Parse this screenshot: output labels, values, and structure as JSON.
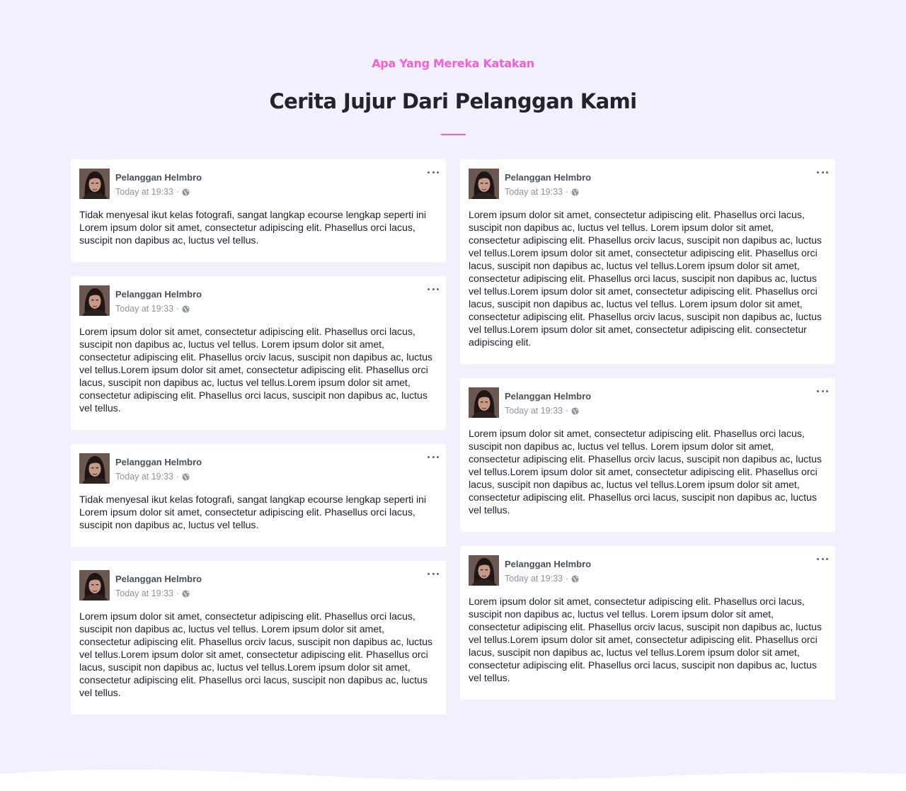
{
  "section": {
    "eyebrow": "Apa Yang Mereka Katakan",
    "title": "Cerita Jujur Dari Pelanggan Kami"
  },
  "colors": {
    "accent": "#f45fd9",
    "background": "#f2f0fc",
    "card": "#ffffff",
    "title": "#23232f"
  },
  "icons": {
    "more": "more-horizontal-icon",
    "privacy": "globe-icon",
    "avatar": "user-avatar"
  },
  "left_posts": [
    {
      "name": "Pelanggan Helmbro",
      "time": "Today at 19:33",
      "text": "Tidak menyesal ikut kelas fotografi, sangat langkap ecourse lengkap seperti ini Lorem ipsum dolor sit amet, consectetur adipiscing elit. Phasellus orci lacus, suscipit non dapibus ac, luctus vel tellus."
    },
    {
      "name": "Pelanggan Helmbro",
      "time": "Today at 19:33",
      "text": "Lorem ipsum dolor sit amet, consectetur adipiscing elit. Phasellus orci lacus, suscipit non dapibus ac, luctus vel tellus. Lorem ipsum dolor sit amet, consectetur adipiscing elit. Phasellus orciv lacus, suscipit non dapibus ac, luctus vel tellus.Lorem ipsum dolor sit amet, consectetur adipiscing elit. Phasellus orci lacus, suscipit non dapibus ac, luctus vel tellus.Lorem ipsum dolor sit amet, consectetur adipiscing elit. Phasellus orci lacus, suscipit non dapibus ac, luctus vel tellus."
    },
    {
      "name": "Pelanggan Helmbro",
      "time": "Today at 19:33",
      "text": "Tidak menyesal ikut kelas fotografi, sangat langkap ecourse lengkap seperti ini Lorem ipsum dolor sit amet, consectetur adipiscing elit. Phasellus orci lacus, suscipit non dapibus ac, luctus vel tellus."
    },
    {
      "name": "Pelanggan Helmbro",
      "time": "Today at 19:33",
      "text": "Lorem ipsum dolor sit amet, consectetur adipiscing elit. Phasellus orci lacus, suscipit non dapibus ac, luctus vel tellus. Lorem ipsum dolor sit amet, consectetur adipiscing elit. Phasellus orciv lacus, suscipit non dapibus ac, luctus vel tellus.Lorem ipsum dolor sit amet, consectetur adipiscing elit. Phasellus orci lacus, suscipit non dapibus ac, luctus vel tellus.Lorem ipsum dolor sit amet, consectetur adipiscing elit. Phasellus orci lacus, suscipit non dapibus ac, luctus vel tellus."
    }
  ],
  "right_posts": [
    {
      "name": "Pelanggan Helmbro",
      "time": "Today at 19:33",
      "text": "Lorem ipsum dolor sit amet, consectetur adipiscing elit. Phasellus orci lacus, suscipit non dapibus ac, luctus vel tellus. Lorem ipsum dolor sit amet, consectetur adipiscing elit. Phasellus orciv lacus, suscipit non dapibus ac, luctus vel tellus.Lorem ipsum dolor sit amet, consectetur adipiscing elit. Phasellus orci lacus, suscipit non dapibus ac, luctus vel tellus.Lorem ipsum dolor sit amet, consectetur adipiscing elit. Phasellus orci lacus, suscipit non dapibus ac, luctus vel tellus.Lorem ipsum dolor sit amet, consectetur adipiscing elit. Phasellus orci lacus, suscipit non dapibus ac, luctus vel tellus. Lorem ipsum dolor sit amet, consectetur adipiscing elit. Phasellus orciv lacus, suscipit non dapibus ac, luctus vel tellus.Lorem ipsum dolor sit amet, consectetur adipiscing elit. consectetur adipiscing elit."
    },
    {
      "name": "Pelanggan Helmbro",
      "time": "Today at 19:33",
      "text": "Lorem ipsum dolor sit amet, consectetur adipiscing elit. Phasellus orci lacus, suscipit non dapibus ac, luctus vel tellus. Lorem ipsum dolor sit amet, consectetur adipiscing elit. Phasellus orciv lacus, suscipit non dapibus ac, luctus vel tellus.Lorem ipsum dolor sit amet, consectetur adipiscing elit. Phasellus orci lacus, suscipit non dapibus ac, luctus vel tellus.Lorem ipsum dolor sit amet, consectetur adipiscing elit. Phasellus orci lacus, suscipit non dapibus ac, luctus vel tellus."
    },
    {
      "name": "Pelanggan Helmbro",
      "time": "Today at 19:33",
      "text": "Lorem ipsum dolor sit amet, consectetur adipiscing elit. Phasellus orci lacus, suscipit non dapibus ac, luctus vel tellus. Lorem ipsum dolor sit amet, consectetur adipiscing elit. Phasellus orciv lacus, suscipit non dapibus ac, luctus vel tellus.Lorem ipsum dolor sit amet, consectetur adipiscing elit. Phasellus orci lacus, suscipit non dapibus ac, luctus vel tellus.Lorem ipsum dolor sit amet, consectetur adipiscing elit. Phasellus orci lacus, suscipit non dapibus ac, luctus vel tellus."
    }
  ]
}
